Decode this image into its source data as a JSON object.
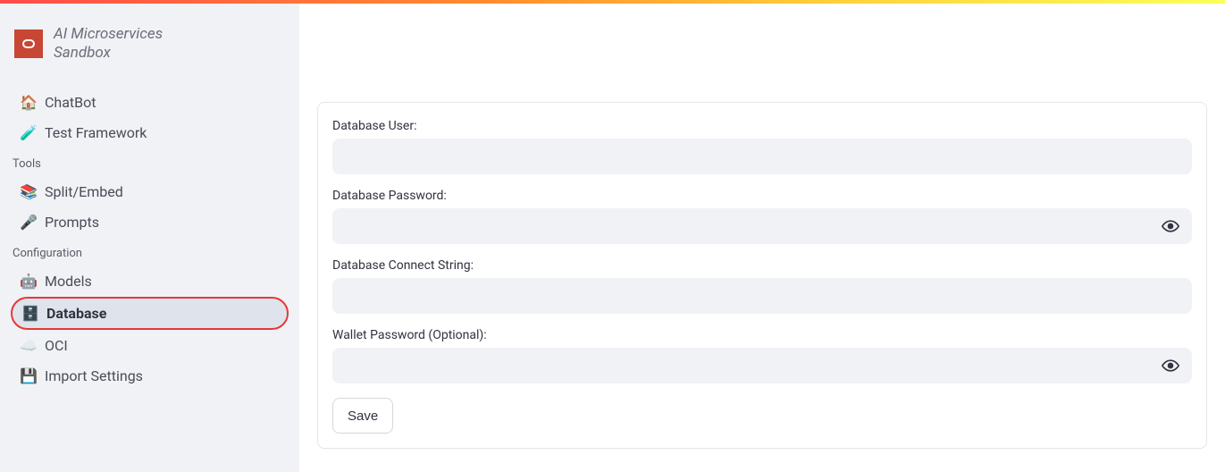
{
  "brand": {
    "title_line1": "AI Microservices",
    "title_line2": "Sandbox"
  },
  "sidebar": {
    "items": [
      {
        "icon": "🏠",
        "label": "ChatBot",
        "selected": false
      },
      {
        "icon": "🧪",
        "label": "Test Framework",
        "selected": false
      }
    ],
    "sections": [
      {
        "label": "Tools",
        "items": [
          {
            "icon": "📚",
            "label": "Split/Embed",
            "selected": false
          },
          {
            "icon": "🎤",
            "label": "Prompts",
            "selected": false
          }
        ]
      },
      {
        "label": "Configuration",
        "items": [
          {
            "icon": "🤖",
            "label": "Models",
            "selected": false
          },
          {
            "icon": "🗄️",
            "label": "Database",
            "selected": true
          },
          {
            "icon": "☁️",
            "label": "OCI",
            "selected": false
          },
          {
            "icon": "💾",
            "label": "Import Settings",
            "selected": false
          }
        ]
      }
    ]
  },
  "form": {
    "fields": [
      {
        "label": "Database User:",
        "type": "text",
        "value": "",
        "eye": false
      },
      {
        "label": "Database Password:",
        "type": "password",
        "value": "",
        "eye": true
      },
      {
        "label": "Database Connect String:",
        "type": "text",
        "value": "",
        "eye": false
      },
      {
        "label": "Wallet Password (Optional):",
        "type": "password",
        "value": "",
        "eye": true
      }
    ],
    "save_label": "Save"
  }
}
